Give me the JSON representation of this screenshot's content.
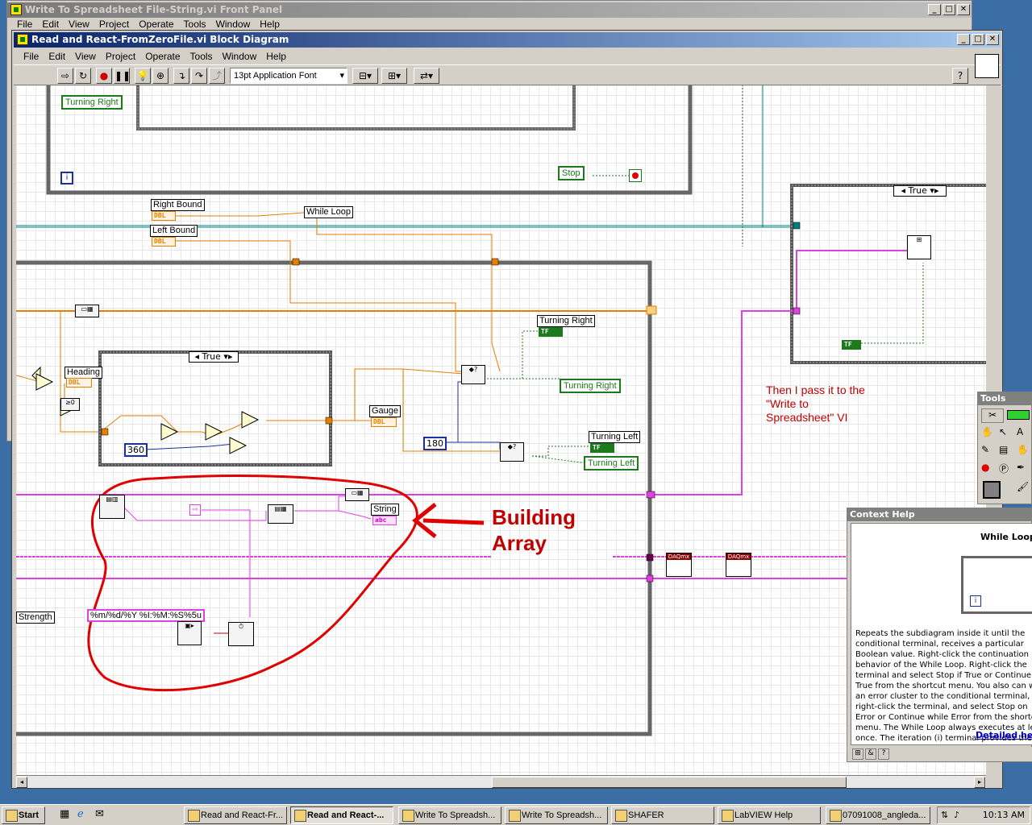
{
  "back_window": {
    "title": "Write To Spreadsheet File-String.vi Front Panel",
    "menu": [
      "File",
      "Edit",
      "View",
      "Project",
      "Operate",
      "Tools",
      "Window",
      "Help"
    ]
  },
  "main_window": {
    "title": "Read and React-FromZeroFile.vi Block Diagram",
    "menu": [
      "File",
      "Edit",
      "View",
      "Project",
      "Operate",
      "Tools",
      "Window",
      "Help"
    ],
    "font_select": "13pt Application Font"
  },
  "diagram": {
    "labels": {
      "turning_right_top": "Turning Right",
      "stop": "Stop",
      "right_bound": "Right Bound",
      "left_bound": "Left Bound",
      "while_loop": "While Loop",
      "heading": "Heading",
      "gauge": "Gauge",
      "turning_right_label": "Turning Right",
      "turning_right_ind": "Turning Right",
      "turning_left_label": "Turning Left",
      "turning_left_ind": "Turning Left",
      "string": "String",
      "strength": "Strength",
      "format_string": "%m/%d/%Y %I:%M:%S%5u",
      "case_true_inner": "True",
      "case_true_right": "True",
      "const_360": "360",
      "const_180": "180",
      "dbl": "DBL",
      "tf": "TF",
      "abc": "abc",
      "daqmx": "DAQmx"
    },
    "annotations": {
      "building_array_line1": "Building",
      "building_array_line2": "Array",
      "then_pass": "Then I pass it to the \"Write to Spreadsheet\" VI"
    },
    "colors": {
      "annotation": "#c00000",
      "dbl_wire": "#e67e00",
      "bool_wire": "#1c7a1c",
      "string_wire": "#e040e0",
      "int_wire": "#1a2fa0",
      "cluster_wire": "#008080"
    }
  },
  "tools_palette": {
    "title": "Tools"
  },
  "context_help": {
    "title": "Context Help",
    "heading": "While Loop",
    "body": "Repeats the subdiagram inside it until the conditional terminal, receives a particular Boolean value. Right-click the continuation behavior of the While Loop. Right-click the terminal and select Stop if True or Continue if True from the shortcut menu. You also can wire an error cluster to the conditional terminal, right-click the terminal, and select Stop on Error or Continue while Error from the shortcut menu. The While Loop always executes at least once. The iteration (i) terminal provides the current loop iteration count, which is zero for the first iteration.",
    "detailed_link": "Detailed help"
  },
  "taskbar": {
    "start": "Start",
    "buttons": [
      "Read and React-Fr...",
      "Read and React-...",
      "Write To Spreadsh...",
      "Write To Spreadsh...",
      "SHAFER",
      "LabVIEW Help",
      "07091008_angleda..."
    ],
    "clock": "10:13 AM"
  }
}
